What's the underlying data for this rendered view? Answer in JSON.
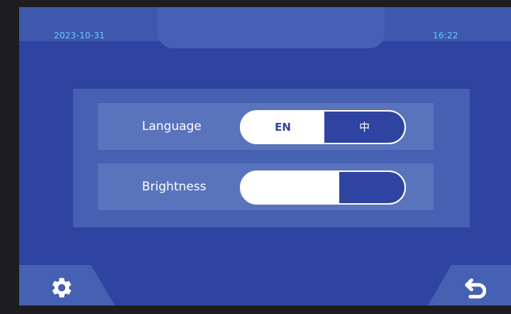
{
  "status_bar": {
    "date": "2023-10-31",
    "time": "16:22"
  },
  "settings": {
    "language": {
      "label": "Language",
      "options": [
        "EN",
        "中"
      ],
      "selected": "中"
    },
    "brightness": {
      "label": "Brightness",
      "level_fraction": 0.6
    }
  },
  "footer": {
    "left_icon": "gear-icon",
    "right_icon": "back-arrow-icon"
  },
  "colors": {
    "background": "#2f44a0",
    "accent_text": "#6fc7ee",
    "panel": "#4660b2",
    "row": "#5a73bd"
  }
}
